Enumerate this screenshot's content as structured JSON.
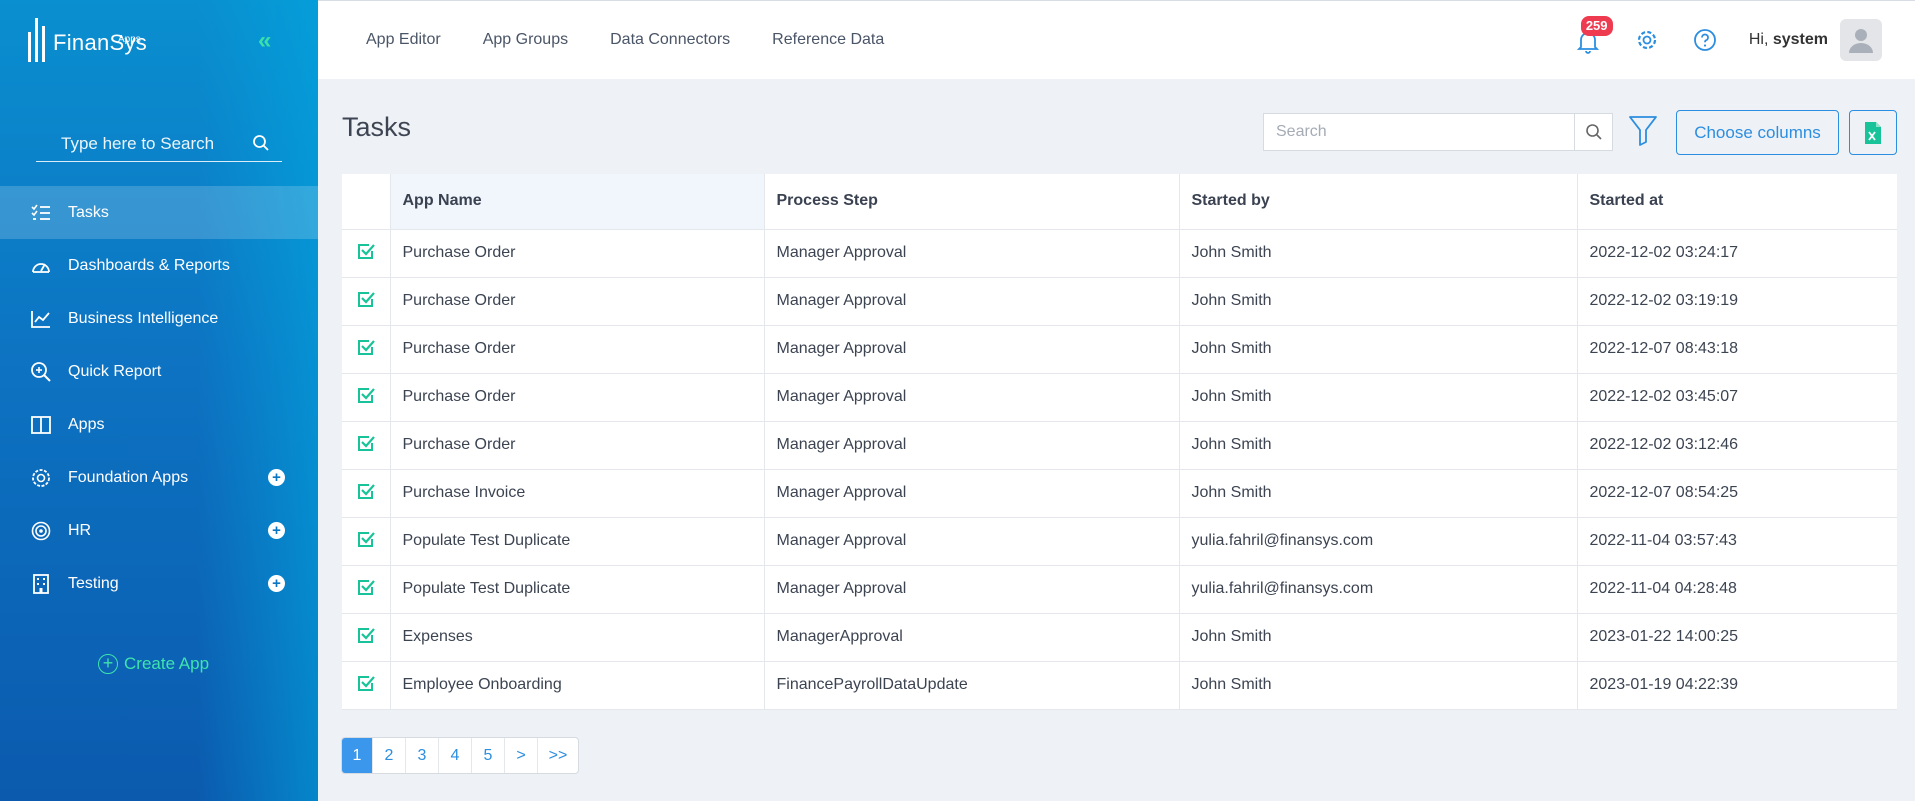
{
  "brand": {
    "name": "FinanSys",
    "sub": "Apps"
  },
  "sidebar": {
    "search_placeholder": "Type here to Search",
    "items": [
      {
        "label": "Tasks",
        "icon": "list-check-icon",
        "active": true,
        "expandable": false
      },
      {
        "label": "Dashboards & Reports",
        "icon": "gauge-icon",
        "active": false,
        "expandable": false
      },
      {
        "label": "Business Intelligence",
        "icon": "line-chart-icon",
        "active": false,
        "expandable": false
      },
      {
        "label": "Quick Report",
        "icon": "zoom-in-icon",
        "active": false,
        "expandable": false
      },
      {
        "label": "Apps",
        "icon": "columns-icon",
        "active": false,
        "expandable": false
      },
      {
        "label": "Foundation Apps",
        "icon": "cog-badge-icon",
        "active": false,
        "expandable": true
      },
      {
        "label": "HR",
        "icon": "target-icon",
        "active": false,
        "expandable": true
      },
      {
        "label": "Testing",
        "icon": "building-icon",
        "active": false,
        "expandable": true
      }
    ],
    "create_app": "Create App"
  },
  "topnav": [
    "App Editor",
    "App Groups",
    "Data Connectors",
    "Reference Data"
  ],
  "header": {
    "notifications": "259",
    "greeting": "Hi,",
    "user": "system"
  },
  "main": {
    "title": "Tasks",
    "search_placeholder": "Search",
    "choose_columns": "Choose columns",
    "columns": [
      "App Name",
      "Process Step",
      "Started by",
      "Started at"
    ],
    "rows": [
      [
        "Purchase Order",
        "Manager Approval",
        "John Smith",
        "2022-12-02 03:24:17"
      ],
      [
        "Purchase Order",
        "Manager Approval",
        "John Smith",
        "2022-12-02 03:19:19"
      ],
      [
        "Purchase Order",
        "Manager Approval",
        "John Smith",
        "2022-12-07 08:43:18"
      ],
      [
        "Purchase Order",
        "Manager Approval",
        "John Smith",
        "2022-12-02 03:45:07"
      ],
      [
        "Purchase Order",
        "Manager Approval",
        "John Smith",
        "2022-12-02 03:12:46"
      ],
      [
        "Purchase Invoice",
        "Manager Approval",
        "John Smith",
        "2022-12-07 08:54:25"
      ],
      [
        "Populate Test Duplicate",
        "Manager Approval",
        "yulia.fahril@finansys.com",
        "2022-11-04 03:57:43"
      ],
      [
        "Populate Test Duplicate",
        "Manager Approval",
        "yulia.fahril@finansys.com",
        "2022-11-04 04:28:48"
      ],
      [
        "Expenses",
        "ManagerApproval",
        "John Smith",
        "2023-01-22 14:00:25"
      ],
      [
        "Employee Onboarding",
        "FinancePayrollDataUpdate",
        "John Smith",
        "2023-01-19 04:22:39"
      ]
    ],
    "pagination": [
      "1",
      "2",
      "3",
      "4",
      "5",
      ">",
      ">>"
    ],
    "current_page": "1"
  },
  "colors": {
    "accent": "#2c8ee0",
    "check": "#19c39a",
    "badge": "#ee3b4f",
    "sidebar": "#0b77c4"
  }
}
